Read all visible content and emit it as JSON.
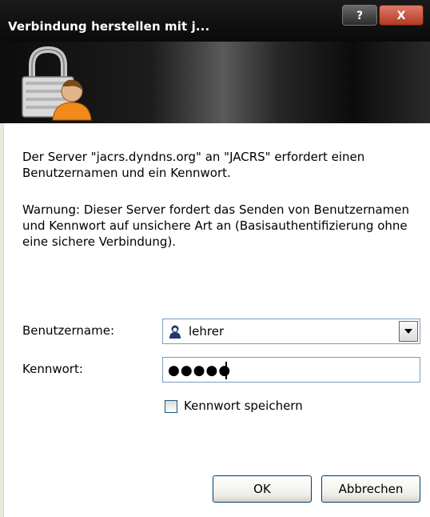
{
  "window": {
    "title": "Verbindung herstellen mit j...",
    "help_label": "?",
    "close_label": "X"
  },
  "banner": {
    "icon": "lock-user-icon"
  },
  "message": {
    "line1": "Der Server \"jacrs.dyndns.org\" an \"JACRS\" erfordert einen Benutzernamen und ein Kennwort.",
    "warning": "Warnung: Dieser Server fordert das Senden von Benutzernamen und Kennwort auf unsichere Art an (Basisauthentifizierung ohne eine sichere Verbindung)."
  },
  "form": {
    "username_label": "Benutzername:",
    "username_value": "lehrer",
    "password_label": "Kennwort:",
    "password_mask": "●●●●●",
    "remember_label": "Kennwort speichern",
    "remember_checked": false
  },
  "buttons": {
    "ok": "OK",
    "cancel": "Abbrechen"
  },
  "colors": {
    "titlebar": "#0a0a0a",
    "close_button": "#c0442a",
    "field_border": "#7f9db9"
  }
}
